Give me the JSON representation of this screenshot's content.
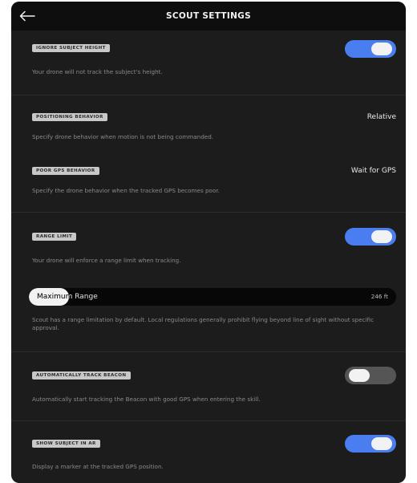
{
  "header": {
    "title": "SCOUT SETTINGS",
    "back_icon": "arrow-left-icon"
  },
  "settings": {
    "ignore_subject_height": {
      "label": "IGNORE SUBJECT HEIGHT",
      "description": "Your drone will not track the subject's height.",
      "enabled": true
    },
    "positioning_behavior": {
      "label": "POSITIONING BEHAVIOR",
      "description": "Specify drone behavior when motion is not being commanded.",
      "value": "Relative"
    },
    "poor_gps_behavior": {
      "label": "POOR GPS BEHAVIOR",
      "description": "Specify the drone behavior when the tracked GPS becomes poor.",
      "value": "Wait for GPS"
    },
    "range_limit": {
      "label": "RANGE LIMIT",
      "description": "Your drone will enforce a range limit when tracking.",
      "enabled": true
    },
    "maximum_range": {
      "label": "Maximum Range",
      "value": "246 ft",
      "fill_fraction": 0.11,
      "description": "Scout has a range limitation by default. Local regulations generally prohibit flying beyond line of sight without specific approval."
    },
    "automatically_track_beacon": {
      "label": "AUTOMATICALLY TRACK BEACON",
      "description": "Automatically start tracking the Beacon with good GPS when entering the skill.",
      "enabled": false
    },
    "show_subject_in_ar": {
      "label": "SHOW SUBJECT IN AR",
      "description": "Display a marker at the tracked GPS position.",
      "enabled": true
    }
  },
  "colors": {
    "accent": "#4a7df0",
    "background": "#1c1c1c",
    "header_background": "#0e0e0e",
    "toggle_off": "#555555"
  }
}
